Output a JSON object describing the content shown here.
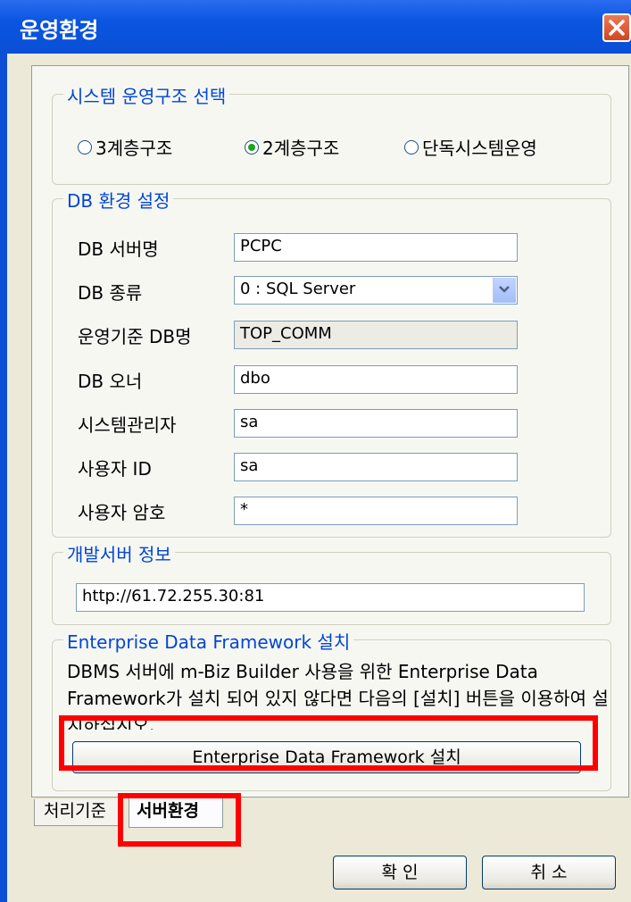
{
  "window": {
    "title": "운영환경"
  },
  "system_structure": {
    "legend": "시스템 운영구조 선택",
    "options": [
      {
        "label": "3계층구조",
        "checked": false
      },
      {
        "label": "2계층구조",
        "checked": true
      },
      {
        "label": "단독시스템운영",
        "checked": false
      }
    ]
  },
  "db": {
    "legend": "DB 환경 설정",
    "fields": [
      {
        "label": "DB 서버명",
        "value": "PCPC"
      },
      {
        "label": "DB 종류",
        "value": "0 : SQL Server"
      },
      {
        "label": "운영기준 DB명",
        "value": "TOP_COMM"
      },
      {
        "label": "DB 오너",
        "value": "dbo"
      },
      {
        "label": "시스템관리자",
        "value": "sa"
      },
      {
        "label": "사용자 ID",
        "value": "sa"
      },
      {
        "label": "사용자 암호",
        "value": "*"
      }
    ]
  },
  "dev_server": {
    "legend": "개발서버 정보",
    "url": "http://61.72.255.30:81"
  },
  "edf": {
    "legend": "Enterprise Data Framework 설치",
    "description": "DBMS 서버에 m-Biz Builder 사용을 위한 Enterprise Data Framework가 설치 되어 있지 않다면 다음의 [설치] 버튼을 이용하여 설치하십시오.",
    "button_label": "Enterprise Data Framework 설치"
  },
  "tabs": [
    {
      "label": "처리기준",
      "active": false
    },
    {
      "label": "서버환경",
      "active": true
    }
  ],
  "footer": {
    "ok_label": "확 인",
    "cancel_label": "취 소"
  },
  "colors": {
    "title_bar": "#0a55e0",
    "highlight": "#ff0000",
    "legend_text": "#0046d5"
  }
}
